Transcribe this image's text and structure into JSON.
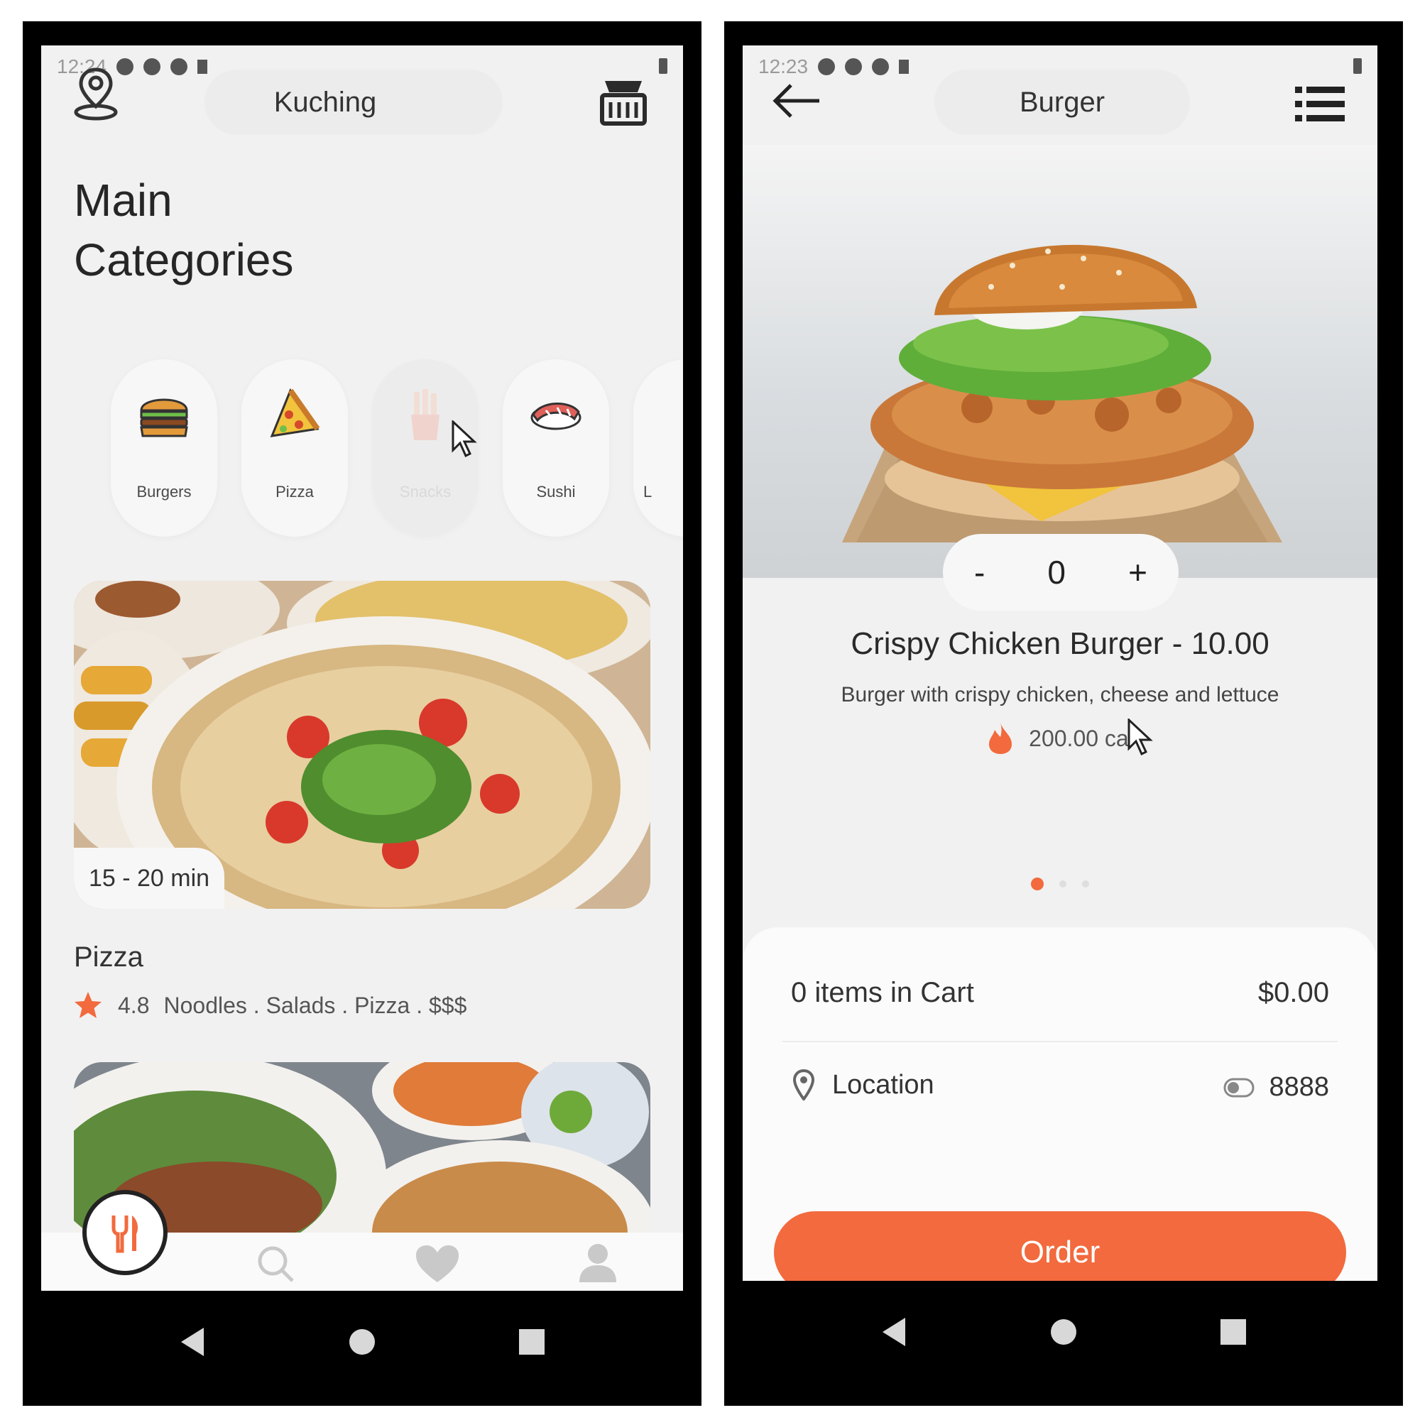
{
  "left": {
    "status_time": "12:24",
    "location_title": "Kuching",
    "heading_line1": "Main",
    "heading_line2": "Categories",
    "categories": [
      {
        "label": "Burgers",
        "icon": "burger-icon"
      },
      {
        "label": "Pizza",
        "icon": "pizza-icon"
      },
      {
        "label": "Snacks",
        "icon": "fries-icon"
      },
      {
        "label": "Sushi",
        "icon": "sushi-icon"
      },
      {
        "label": "L",
        "icon": "category-icon"
      }
    ],
    "restaurant": {
      "eta": "15 - 20 min",
      "name": "Pizza",
      "rating": "4.8",
      "tags": "Noodles . Salads . Pizza . $$$"
    },
    "bottom_nav": [
      "cutlery-icon",
      "search-icon",
      "heart-icon",
      "user-icon"
    ]
  },
  "right": {
    "status_time": "12:23",
    "title": "Burger",
    "quantity": {
      "minus": "-",
      "value": "0",
      "plus": "+"
    },
    "product_title": "Crispy Chicken Burger - 10.00",
    "description": "Burger with crispy chicken, cheese and lettuce",
    "calories": "200.00 cal",
    "carousel": {
      "count": 3,
      "active": 1
    },
    "cart_summary": "0 items in Cart",
    "cart_total": "$0.00",
    "location_label": "Location",
    "location_value": "8888",
    "order_button": "Order"
  },
  "colors": {
    "accent": "#f26a3d",
    "screen_bg": "#f1f1f1",
    "phone_frame": "#000000"
  }
}
